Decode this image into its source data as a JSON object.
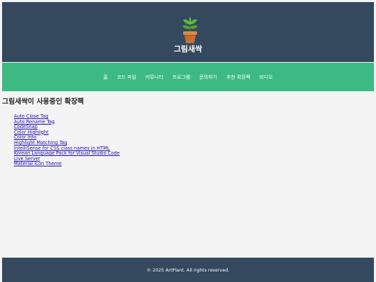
{
  "header": {
    "logo_icon": "potted-plant-icon",
    "site_title": "그림새싹"
  },
  "nav": {
    "items": [
      {
        "label": "홈"
      },
      {
        "label": "코드 파일"
      },
      {
        "label": "커뮤니티"
      },
      {
        "label": "프로그램"
      },
      {
        "label": "문의하기"
      },
      {
        "label": "추천 확장팩"
      },
      {
        "label": "비디오"
      }
    ]
  },
  "main": {
    "section_title": "그림새싹이 사용중인 확장팩",
    "extensions": [
      {
        "label": "Auto Close Tag"
      },
      {
        "label": "Auto Rename Tag"
      },
      {
        "label": "CodeSnap"
      },
      {
        "label": "Color Highlight"
      },
      {
        "label": "Color Info"
      },
      {
        "label": "Highlight Matching Tag"
      },
      {
        "label": "IntelliSense for CSS class names in HTML"
      },
      {
        "label": "Korean Language Pack for Visual Studio Code"
      },
      {
        "label": "Live Server"
      },
      {
        "label": "Material Icon Theme"
      }
    ]
  },
  "footer": {
    "copyright": "© 2025 ArtPlant. All rights reserved."
  },
  "colors": {
    "header_bg": "#34495e",
    "nav_bg": "#3dba83",
    "link": "#1a0dab",
    "page_bg": "#f4f4f4"
  }
}
